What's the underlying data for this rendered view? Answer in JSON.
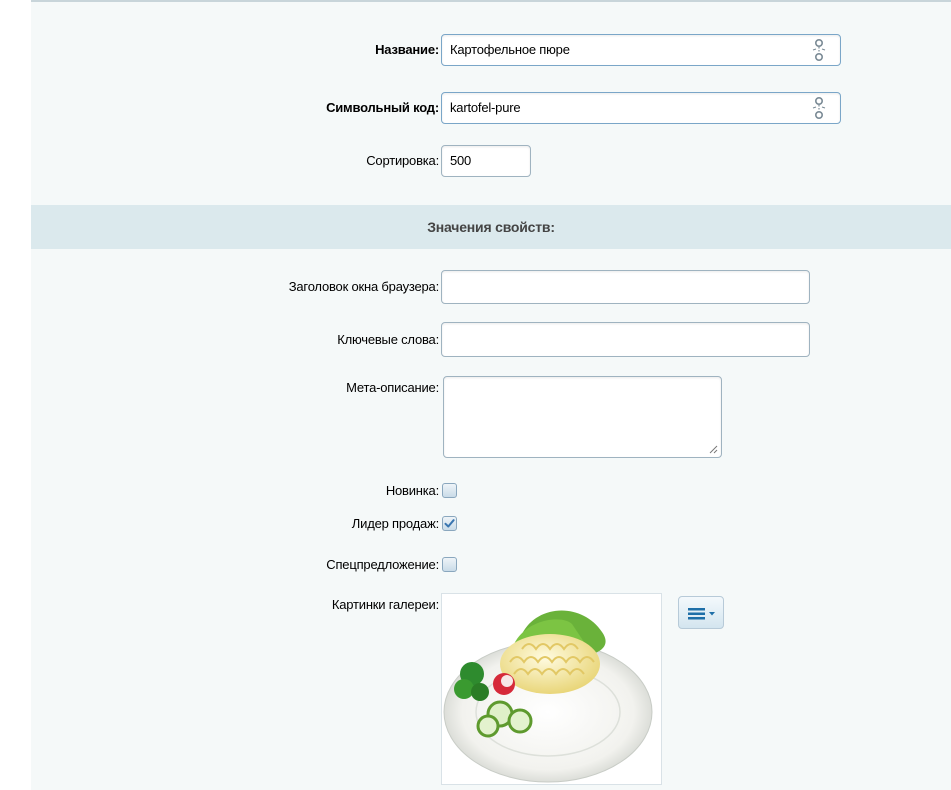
{
  "form": {
    "name": {
      "label": "Название:",
      "value": "Картофельное пюре"
    },
    "code": {
      "label": "Символьный код:",
      "value": "kartofel-pure"
    },
    "sort": {
      "label": "Сортировка:",
      "value": "500"
    }
  },
  "properties": {
    "header": "Значения свойств:",
    "browser_title": {
      "label": "Заголовок окна браузера:",
      "value": ""
    },
    "keywords": {
      "label": "Ключевые слова:",
      "value": ""
    },
    "meta_description": {
      "label": "Мета-описание:",
      "value": ""
    },
    "new_item": {
      "label": "Новинка:",
      "checked": false
    },
    "bestseller": {
      "label": "Лидер продаж:",
      "checked": true
    },
    "special_offer": {
      "label": "Спецпредложение:",
      "checked": false
    },
    "gallery": {
      "label": "Картинки галереи:"
    }
  },
  "icons": {
    "link": "chain-link-icon",
    "menu": "hamburger-menu-icon",
    "dropdown": "chevron-down-icon",
    "check": "checkmark-icon"
  },
  "colors": {
    "background": "#f5f9f9",
    "section_header": "#dbe9ed",
    "input_border": "#9fb3c0",
    "check": "#3a76b0"
  }
}
